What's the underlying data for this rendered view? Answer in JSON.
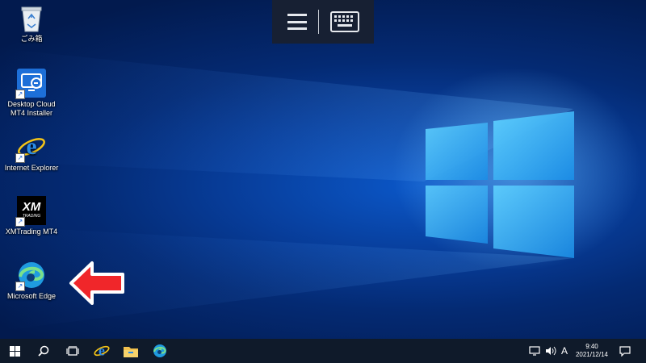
{
  "desktop": {
    "icons": [
      {
        "label": "ごみ箱",
        "icon": "recycle-bin-icon"
      },
      {
        "label": "Desktop Cloud MT4 Installer",
        "icon": "desktop-cloud-installer-icon"
      },
      {
        "label": "Internet Explorer",
        "icon": "internet-explorer-icon"
      },
      {
        "label": "XMTrading MT4",
        "icon": "xmtrading-icon"
      },
      {
        "label": "Microsoft Edge",
        "icon": "microsoft-edge-icon"
      }
    ],
    "xm_logo_text": "XM",
    "xm_logo_sub": "TRADING"
  },
  "remote_toolbar": {
    "menu_icon": "hamburger-menu-icon",
    "keyboard_icon": "keyboard-icon"
  },
  "taskbar": {
    "clock_time": "9:40",
    "clock_date": "2021/12/14",
    "ime_label": "A",
    "pinned": [
      "start-icon",
      "search-icon",
      "task-view-icon",
      "internet-explorer-icon",
      "file-explorer-icon",
      "microsoft-edge-icon"
    ]
  },
  "colors": {
    "annotation_arrow": "#f0262a",
    "taskbar_bg": "#0f1a2a",
    "toolbar_bg": "#172033"
  }
}
